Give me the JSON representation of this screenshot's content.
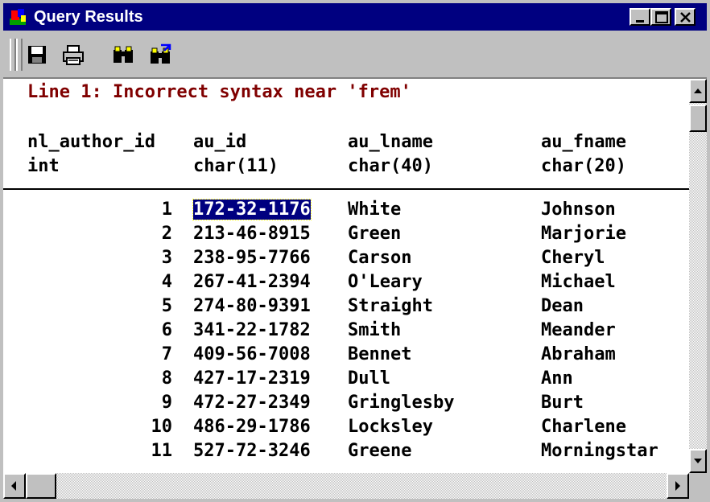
{
  "window": {
    "title": "Query Results",
    "app_icon": "query-results-icon"
  },
  "title_buttons": [
    {
      "name": "minimize-button",
      "icon": "minimize-icon"
    },
    {
      "name": "maximize-button",
      "icon": "maximize-icon"
    },
    {
      "name": "close-button",
      "icon": "close-icon"
    }
  ],
  "toolbar": {
    "tools": [
      {
        "name": "save-button",
        "icon": "floppy-disk-icon"
      },
      {
        "name": "print-button",
        "icon": "printer-icon"
      },
      {
        "name": "find-button",
        "icon": "binoculars-icon"
      },
      {
        "name": "find-next-button",
        "icon": "binoculars-arrow-icon"
      }
    ]
  },
  "results": {
    "error_message": "Line 1: Incorrect syntax near 'frem'",
    "columns": [
      {
        "name": "nl_author_id",
        "type": "int"
      },
      {
        "name": "au_id",
        "type": "char(11)"
      },
      {
        "name": "au_lname",
        "type": "char(40)"
      },
      {
        "name": "au_fname",
        "type": "char(20)"
      }
    ],
    "selected_cell": "172-32-1176",
    "rows": [
      [
        "1",
        "172-32-1176",
        "White",
        "Johnson"
      ],
      [
        "2",
        "213-46-8915",
        "Green",
        "Marjorie"
      ],
      [
        "3",
        "238-95-7766",
        "Carson",
        "Cheryl"
      ],
      [
        "4",
        "267-41-2394",
        "O'Leary",
        "Michael"
      ],
      [
        "5",
        "274-80-9391",
        "Straight",
        "Dean"
      ],
      [
        "6",
        "341-22-1782",
        "Smith",
        "Meander"
      ],
      [
        "7",
        "409-56-7008",
        "Bennet",
        "Abraham"
      ],
      [
        "8",
        "427-17-2319",
        "Dull",
        "Ann"
      ],
      [
        "9",
        "472-27-2349",
        "Gringlesby",
        "Burt"
      ],
      [
        "10",
        "486-29-1786",
        "Locksley",
        "Charlene"
      ],
      [
        "11",
        "527-72-3246",
        "Greene",
        "Morningstar"
      ]
    ]
  },
  "colors": {
    "titlebar": "#000080",
    "error_text": "#800000",
    "selection": "#000080"
  }
}
